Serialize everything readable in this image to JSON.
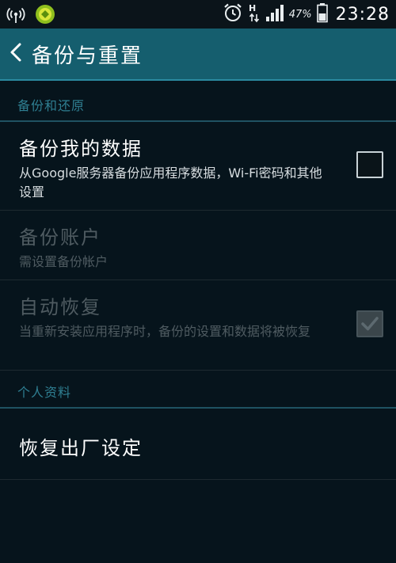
{
  "status_bar": {
    "icons": [
      "wireless-broadcast-icon",
      "app-notification-icon",
      "alarm-icon",
      "hspa-data-icon",
      "signal-icon",
      "battery-icon"
    ],
    "network_type": "H",
    "battery": "47%",
    "time": "23:28"
  },
  "action_bar": {
    "back_icon": "chevron-left-icon",
    "title": "备份与重置"
  },
  "sections": {
    "backup_restore": {
      "header": "备份和还原",
      "items": [
        {
          "title": "备份我的数据",
          "summary": "从Google服务器备份应用程序数据，Wi-Fi密码和其他设置",
          "checked": false,
          "enabled": true
        },
        {
          "title": "备份账户",
          "summary": "需设置备份帐户",
          "enabled": false
        },
        {
          "title": "自动恢复",
          "summary": "当重新安装应用程序时，备份的设置和数据将被恢复",
          "checked": true,
          "enabled": false
        }
      ]
    },
    "personal": {
      "header": "个人资料",
      "items": [
        {
          "title": "恢复出厂设定",
          "enabled": true
        }
      ]
    }
  },
  "colors": {
    "action_bar": "#155e6e",
    "section_header_text": "#2f7f92",
    "background": "#06141c",
    "disabled_text": "#4f5b61"
  }
}
